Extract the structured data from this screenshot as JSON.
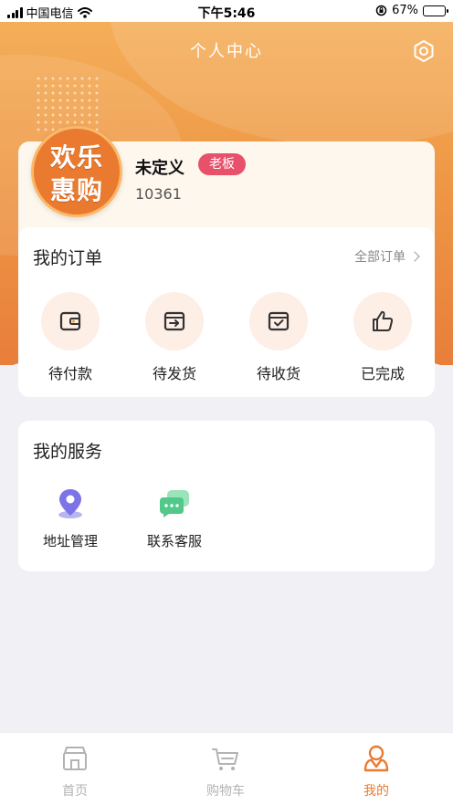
{
  "status_bar": {
    "carrier": "中国电信",
    "time": "下午5:46",
    "battery": "67%",
    "battery_level": 0.67
  },
  "header": {
    "title": "个人中心"
  },
  "profile": {
    "avatar_line1": "欢乐",
    "avatar_line2": "惠购",
    "name": "未定义",
    "role": "老板",
    "id": "10361"
  },
  "orders": {
    "title": "我的订单",
    "view_all": "全部订单",
    "items": [
      {
        "label": "待付款",
        "icon": "wallet-icon"
      },
      {
        "label": "待发货",
        "icon": "ship-box-icon"
      },
      {
        "label": "待收货",
        "icon": "receive-box-icon"
      },
      {
        "label": "已完成",
        "icon": "thumbs-up-icon"
      }
    ]
  },
  "services": {
    "title": "我的服务",
    "items": [
      {
        "label": "地址管理",
        "icon": "location-pin-icon"
      },
      {
        "label": "联系客服",
        "icon": "chat-bubbles-icon"
      }
    ]
  },
  "tabbar": {
    "items": [
      {
        "label": "首页",
        "icon": "home-store-icon",
        "active": false
      },
      {
        "label": "购物车",
        "icon": "cart-icon",
        "active": false
      },
      {
        "label": "我的",
        "icon": "user-icon",
        "active": true
      }
    ]
  },
  "colors": {
    "accent": "#ea7a2f",
    "badge": "#e8516a",
    "hero_top": "#f5b15c",
    "hero_bottom": "#e87e3a",
    "tab_inactive": "#b3b3b3"
  }
}
